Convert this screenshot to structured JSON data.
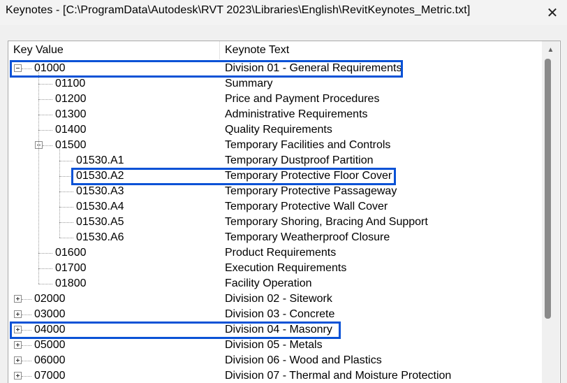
{
  "window": {
    "title": "Keynotes - [C:\\ProgramData\\Autodesk\\RVT 2023\\Libraries\\English\\RevitKeynotes_Metric.txt]",
    "close_glyph": "✕"
  },
  "columns": {
    "key": "Key Value",
    "text": "Keynote Text"
  },
  "rows": [
    {
      "key": "01000",
      "text": "Division 01 - General Requirements",
      "level": 0,
      "expander": "collapse",
      "highlighted": true
    },
    {
      "key": "01100",
      "text": "Summary",
      "level": 1
    },
    {
      "key": "01200",
      "text": "Price and Payment Procedures",
      "level": 1
    },
    {
      "key": "01300",
      "text": "Administrative Requirements",
      "level": 1
    },
    {
      "key": "01400",
      "text": "Quality Requirements",
      "level": 1
    },
    {
      "key": "01500",
      "text": "Temporary Facilities and Controls",
      "level": 1,
      "expander": "collapse"
    },
    {
      "key": "01530.A1",
      "text": "Temporary Dustproof Partition",
      "level": 2
    },
    {
      "key": "01530.A2",
      "text": "Temporary Protective Floor Cover",
      "level": 2,
      "highlighted": true
    },
    {
      "key": "01530.A3",
      "text": "Temporary Protective Passageway",
      "level": 2
    },
    {
      "key": "01530.A4",
      "text": "Temporary Protective Wall Cover",
      "level": 2
    },
    {
      "key": "01530.A5",
      "text": "Temporary Shoring, Bracing And Support",
      "level": 2
    },
    {
      "key": "01530.A6",
      "text": "Temporary Weatherproof Closure",
      "level": 2
    },
    {
      "key": "01600",
      "text": "Product Requirements",
      "level": 1
    },
    {
      "key": "01700",
      "text": "Execution Requirements",
      "level": 1
    },
    {
      "key": "01800",
      "text": "Facility Operation",
      "level": 1
    },
    {
      "key": "02000",
      "text": "Division 02 - Sitework",
      "level": 0,
      "expander": "expand"
    },
    {
      "key": "03000",
      "text": "Division 03 - Concrete",
      "level": 0,
      "expander": "expand"
    },
    {
      "key": "04000",
      "text": "Division 04 - Masonry",
      "level": 0,
      "expander": "expand",
      "highlighted": true
    },
    {
      "key": "05000",
      "text": "Division 05 - Metals",
      "level": 0,
      "expander": "expand"
    },
    {
      "key": "06000",
      "text": "Division 06 - Wood and Plastics",
      "level": 0,
      "expander": "expand"
    },
    {
      "key": "07000",
      "text": "Division 07 - Thermal and Moisture Protection",
      "level": 0,
      "expander": "expand"
    }
  ],
  "colors": {
    "highlight": "#0a52d6",
    "tree_lines": "#9a9a9a",
    "scroll_thumb": "#8a8a8a"
  },
  "scrollbar": {
    "up_glyph": "▲"
  }
}
